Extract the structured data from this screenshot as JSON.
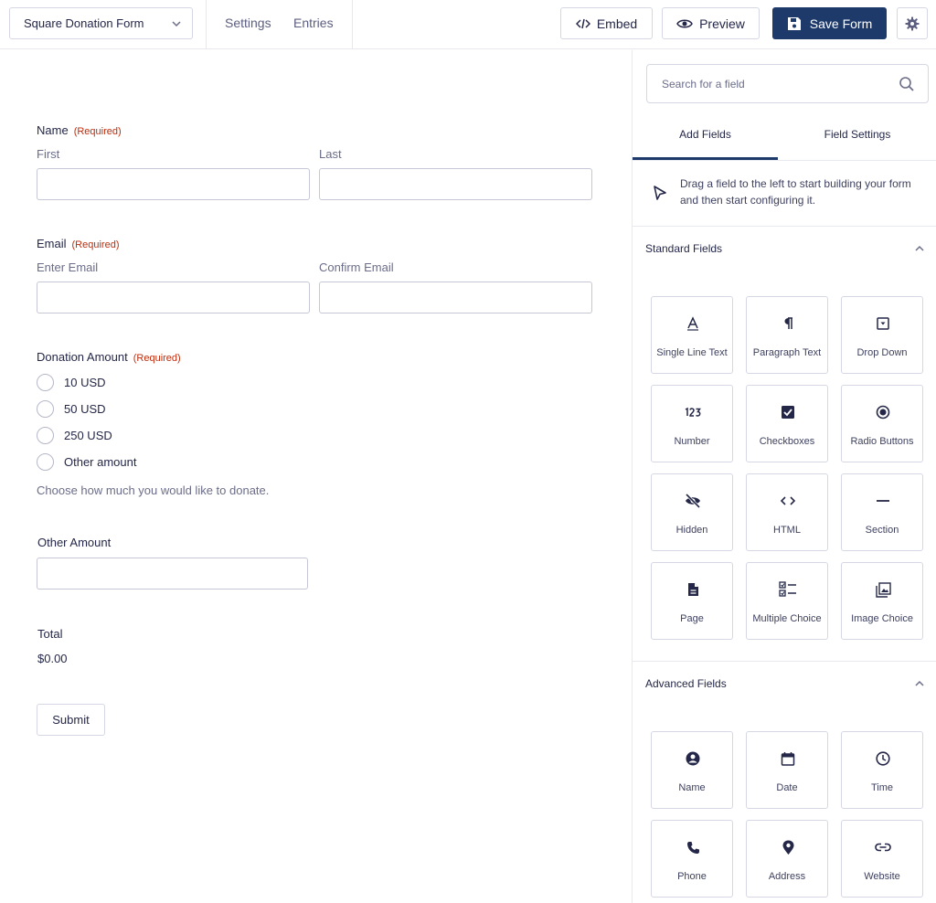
{
  "colors": {
    "accent": "#1e3a6b",
    "required": "#c02b0a",
    "text": "#242748",
    "muted": "#6b6d89",
    "border": "#d5d7e5"
  },
  "header": {
    "form_selector": "Square Donation Form",
    "settings_link": "Settings",
    "entries_link": "Entries",
    "embed_label": "Embed",
    "preview_label": "Preview",
    "save_label": "Save Form"
  },
  "form": {
    "required_text": "(Required)",
    "name": {
      "label": "Name",
      "first": "First",
      "last": "Last"
    },
    "email": {
      "label": "Email",
      "enter": "Enter Email",
      "confirm": "Confirm Email"
    },
    "donation": {
      "label": "Donation Amount",
      "options": [
        "10 USD",
        "50 USD",
        "250 USD",
        "Other amount"
      ],
      "description": "Choose how much you would like to donate."
    },
    "other_amount": {
      "label": "Other Amount"
    },
    "total": {
      "label": "Total",
      "value": "$0.00"
    },
    "submit_label": "Submit"
  },
  "sidebar": {
    "search_placeholder": "Search for a field",
    "tabs": [
      "Add Fields",
      "Field Settings"
    ],
    "hint": "Drag a field to the left to start building your form and then start configuring it.",
    "standard": {
      "title": "Standard Fields",
      "fields": [
        {
          "label": "Single Line Text",
          "icon": "text-cursor-icon"
        },
        {
          "label": "Paragraph Text",
          "icon": "paragraph-icon"
        },
        {
          "label": "Drop Down",
          "icon": "dropdown-icon"
        },
        {
          "label": "Number",
          "icon": "number-icon"
        },
        {
          "label": "Checkboxes",
          "icon": "checkbox-icon"
        },
        {
          "label": "Radio Buttons",
          "icon": "radio-icon"
        },
        {
          "label": "Hidden",
          "icon": "eye-off-icon"
        },
        {
          "label": "HTML",
          "icon": "code-icon"
        },
        {
          "label": "Section",
          "icon": "minus-icon"
        },
        {
          "label": "Page",
          "icon": "page-icon"
        },
        {
          "label": "Multiple Choice",
          "icon": "multiple-choice-icon"
        },
        {
          "label": "Image Choice",
          "icon": "image-icon"
        }
      ]
    },
    "advanced": {
      "title": "Advanced Fields",
      "fields": [
        {
          "label": "Name",
          "icon": "person-icon"
        },
        {
          "label": "Date",
          "icon": "calendar-icon"
        },
        {
          "label": "Time",
          "icon": "clock-icon"
        },
        {
          "label": "Phone",
          "icon": "phone-icon"
        },
        {
          "label": "Address",
          "icon": "map-pin-icon"
        },
        {
          "label": "Website",
          "icon": "link-icon"
        }
      ]
    }
  }
}
